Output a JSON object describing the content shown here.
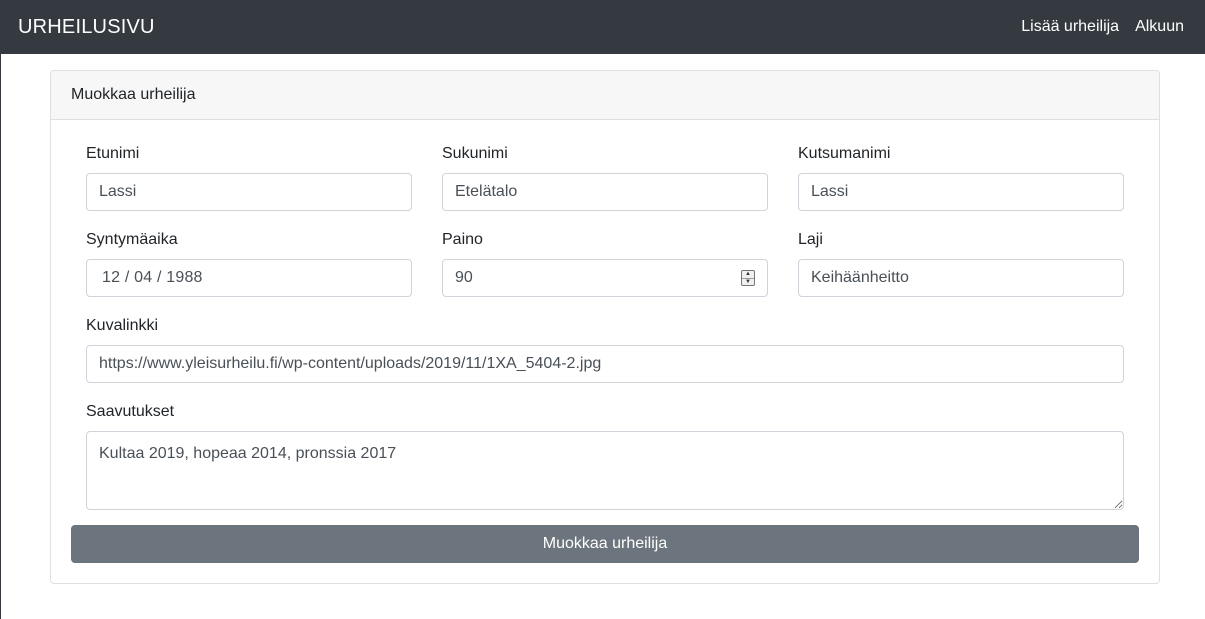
{
  "navbar": {
    "brand": "URHEILUSIVU",
    "links": [
      {
        "label": "Lisää urheilija"
      },
      {
        "label": "Alkuun"
      }
    ]
  },
  "card": {
    "title": "Muokkaa urheilija"
  },
  "form": {
    "etunimi": {
      "label": "Etunimi",
      "value": "Lassi"
    },
    "sukunimi": {
      "label": "Sukunimi",
      "value": "Etelätalo"
    },
    "kutsumanimi": {
      "label": "Kutsumanimi",
      "value": "Lassi"
    },
    "syntymaaika": {
      "label": "Syntymäaika",
      "value": "12 / 04 / 1988"
    },
    "paino": {
      "label": "Paino",
      "value": "90"
    },
    "laji": {
      "label": "Laji",
      "value": "Keihäänheitto"
    },
    "kuvalinkki": {
      "label": "Kuvalinkki",
      "value": "https://www.yleisurheilu.fi/wp-content/uploads/2019/11/1XA_5404-2.jpg"
    },
    "saavutukset": {
      "label": "Saavutukset",
      "value": "Kultaa 2019, hopeaa 2014, pronssia 2017"
    },
    "submit_label": "Muokkaa urheilija"
  },
  "colors": {
    "navbar_bg": "#343a40",
    "button_bg": "#6c757d",
    "card_header_bg": "#f7f7f7"
  }
}
